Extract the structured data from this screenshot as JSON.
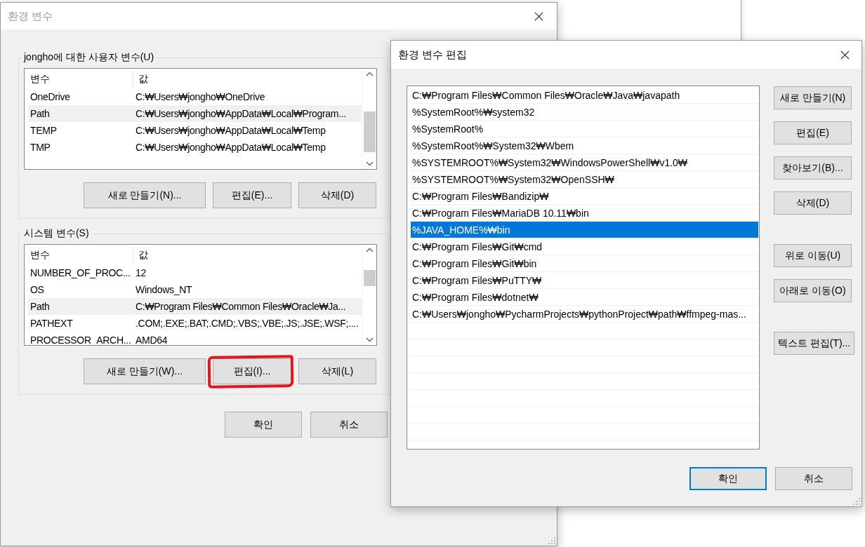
{
  "env_dialog": {
    "title": "환경 변수",
    "active": false,
    "user_group": {
      "title": "jongho에 대한 사용자 변수(U)",
      "columns": [
        "변수",
        "값"
      ],
      "rows": [
        {
          "name": "OneDrive",
          "value": "C:₩Users₩jongho₩OneDrive",
          "selected": false
        },
        {
          "name": "Path",
          "value": "C:₩Users₩jongho₩AppData₩Local₩Program...",
          "selected": true
        },
        {
          "name": "TEMP",
          "value": "C:₩Users₩jongho₩AppData₩Local₩Temp",
          "selected": false
        },
        {
          "name": "TMP",
          "value": "C:₩Users₩jongho₩AppData₩Local₩Temp",
          "selected": false
        }
      ],
      "buttons": [
        {
          "label": "새로 만들기(N)...",
          "annotated": false
        },
        {
          "label": "편집(E)...",
          "annotated": false
        },
        {
          "label": "삭제(D)",
          "annotated": false
        }
      ]
    },
    "system_group": {
      "title": "시스템 변수(S)",
      "columns": [
        "변수",
        "값"
      ],
      "rows": [
        {
          "name": "NUMBER_OF_PROC...",
          "value": "12",
          "selected": false
        },
        {
          "name": "OS",
          "value": "Windows_NT",
          "selected": false
        },
        {
          "name": "Path",
          "value": "C:₩Program Files₩Common Files₩Oracle₩Ja...",
          "selected": true
        },
        {
          "name": "PATHEXT",
          "value": ".COM;.EXE;.BAT;.CMD;.VBS;.VBE;.JS;.JSE;.WSF;....",
          "selected": false
        },
        {
          "name": "PROCESSOR_ARCH...",
          "value": "AMD64",
          "selected": false
        }
      ],
      "buttons": [
        {
          "label": "새로 만들기(W)...",
          "annotated": false
        },
        {
          "label": "편집(I)...",
          "annotated": true
        },
        {
          "label": "삭제(L)",
          "annotated": false
        }
      ]
    },
    "footer_buttons": [
      {
        "label": "확인",
        "default": false
      },
      {
        "label": "취소",
        "default": false
      }
    ]
  },
  "edit_dialog": {
    "title": "환경 변수 편집",
    "active": true,
    "entries": [
      {
        "text": "C:₩Program Files₩Common Files₩Oracle₩Java₩javapath",
        "selected": false
      },
      {
        "text": "%SystemRoot%₩system32",
        "selected": false
      },
      {
        "text": "%SystemRoot%",
        "selected": false
      },
      {
        "text": "%SystemRoot%₩System32₩Wbem",
        "selected": false
      },
      {
        "text": "%SYSTEMROOT%₩System32₩WindowsPowerShell₩v1.0₩",
        "selected": false
      },
      {
        "text": "%SYSTEMROOT%₩System32₩OpenSSH₩",
        "selected": false
      },
      {
        "text": "C:₩Program Files₩Bandizip₩",
        "selected": false
      },
      {
        "text": "C:₩Program Files₩MariaDB 10.11₩bin",
        "selected": false
      },
      {
        "text": "%JAVA_HOME%₩bin",
        "selected": true
      },
      {
        "text": "C:₩Program Files₩Git₩cmd",
        "selected": false
      },
      {
        "text": "C:₩Program Files₩Git₩bin",
        "selected": false
      },
      {
        "text": "C:₩Program Files₩PuTTY₩",
        "selected": false
      },
      {
        "text": "C:₩Program Files₩dotnet₩",
        "selected": false
      },
      {
        "text": "C:₩Users₩jongho₩PycharmProjects₩pythonProject₩path₩ffmpeg-mas...",
        "selected": false
      }
    ],
    "side_button_groups": [
      [
        "새로 만들기(N)",
        "편집(E)",
        "찾아보기(B)...",
        "삭제(D)"
      ],
      [
        "위로 이동(U)",
        "아래로 이동(O)"
      ],
      [
        "텍스트 편집(T)..."
      ]
    ],
    "footer_buttons": [
      {
        "label": "확인",
        "default": true
      },
      {
        "label": "취소",
        "default": false
      }
    ]
  }
}
